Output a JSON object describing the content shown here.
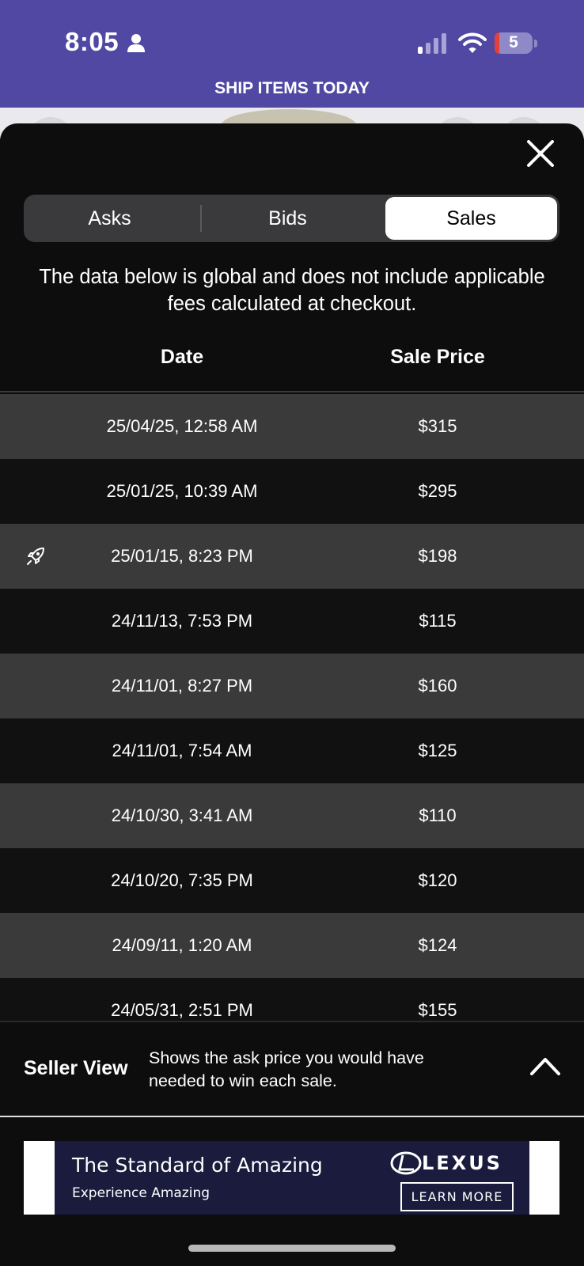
{
  "status_bar": {
    "time": "8:05",
    "battery_level": "5",
    "icons": [
      "person-icon",
      "signal-icon",
      "wifi-icon",
      "battery-icon"
    ]
  },
  "banner": {
    "text": "SHIP ITEMS TODAY"
  },
  "segmented_control": {
    "tabs": [
      {
        "label": "Asks",
        "active": false
      },
      {
        "label": "Bids",
        "active": false
      },
      {
        "label": "Sales",
        "active": true
      }
    ]
  },
  "notice": "The data below is global and does not include applicable fees calculated at checkout.",
  "table": {
    "headers": {
      "date": "Date",
      "price": "Sale Price"
    },
    "rows": [
      {
        "date": "25/04/25, 12:58 AM",
        "price": "$315",
        "icon": ""
      },
      {
        "date": "25/01/25, 10:39 AM",
        "price": "$295",
        "icon": ""
      },
      {
        "date": "25/01/15, 8:23 PM",
        "price": "$198",
        "icon": "rocket-icon"
      },
      {
        "date": "24/11/13, 7:53 PM",
        "price": "$115",
        "icon": ""
      },
      {
        "date": "24/11/01, 8:27 PM",
        "price": "$160",
        "icon": ""
      },
      {
        "date": "24/11/01, 7:54 AM",
        "price": "$125",
        "icon": ""
      },
      {
        "date": "24/10/30, 3:41 AM",
        "price": "$110",
        "icon": ""
      },
      {
        "date": "24/10/20, 7:35 PM",
        "price": "$120",
        "icon": ""
      },
      {
        "date": "24/09/11, 1:20 AM",
        "price": "$124",
        "icon": ""
      },
      {
        "date": "24/05/31, 2:51 PM",
        "price": "$155",
        "icon": ""
      }
    ]
  },
  "seller_view": {
    "title": "Seller View",
    "description": "Shows the ask price you would have needed to win each sale."
  },
  "ad": {
    "headline": "The Standard of Amazing",
    "subline": "Experience Amazing",
    "brand": "LEXUS",
    "cta": "LEARN MORE"
  },
  "colors": {
    "banner": "#5048a3",
    "sheet": "#0d0d0d",
    "row_even": "#3a3a3a",
    "row_odd": "#111111",
    "ad_background": "#1a1b3d"
  }
}
